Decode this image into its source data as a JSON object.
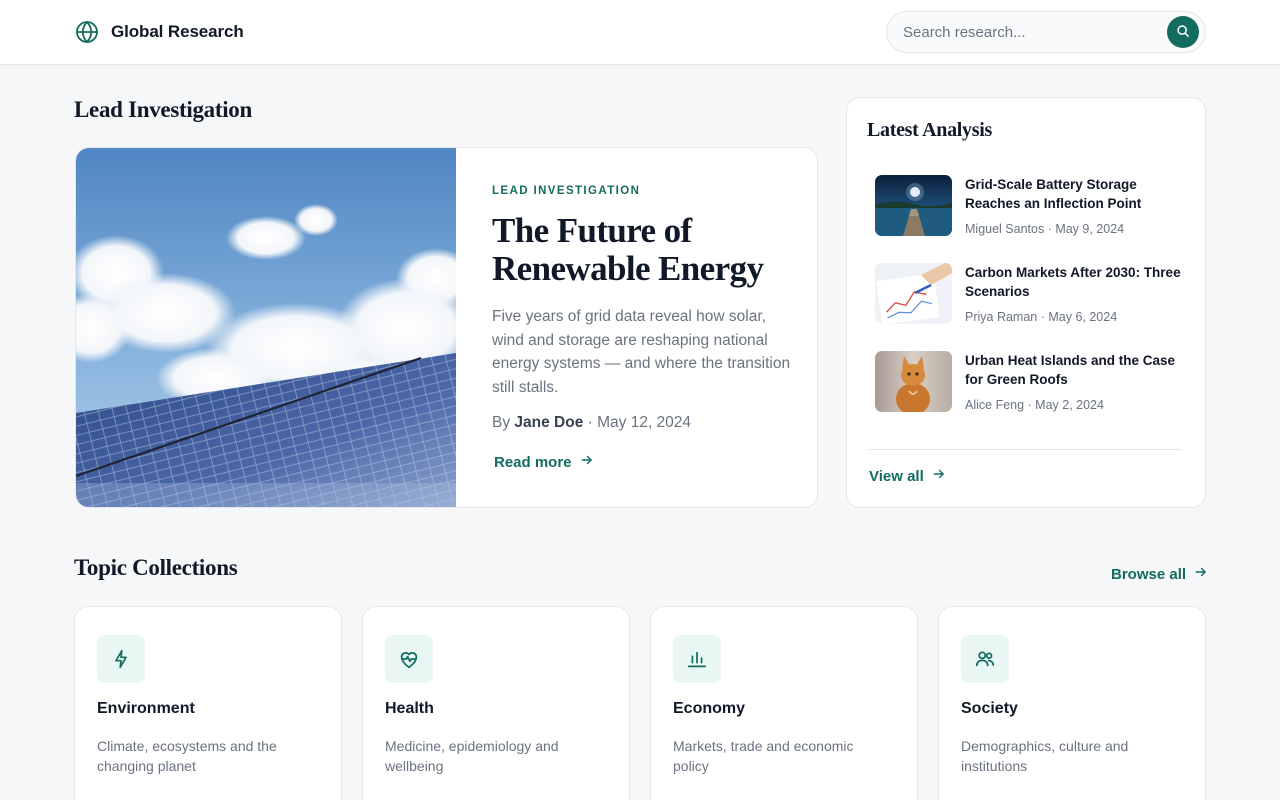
{
  "header": {
    "brand_name": "Global Research",
    "search_placeholder": "Search research..."
  },
  "lead": {
    "section_title": "Lead Investigation",
    "eyebrow": "LEAD INVESTIGATION",
    "title": "The Future of Renewable Energy",
    "description": "Five years of grid data reveal how solar, wind and storage are reshaping national energy systems — and where the transition still stalls.",
    "by_prefix": "By",
    "author": "Jane Doe",
    "date": "· May 12, 2024",
    "read_more": "Read more",
    "image_alt": "Solar panels under a blue sky with clouds"
  },
  "latest": {
    "title": "Latest Analysis",
    "items": [
      {
        "title": "Grid-Scale Battery Storage Reaches an Inflection Point",
        "meta": "Miguel Santos · May 9, 2024",
        "thumb": "pier-at-night"
      },
      {
        "title": "Carbon Markets After 2030: Three Scenarios",
        "meta": "Priya Raman · May 6, 2024",
        "thumb": "hand-charts"
      },
      {
        "title": "Urban Heat Islands and the Case for Green Roofs",
        "meta": "Alice Feng · May 2, 2024",
        "thumb": "orange-cat"
      }
    ],
    "view_all": "View all"
  },
  "topics": {
    "section_title": "Topic Collections",
    "browse_all": "Browse all",
    "items": [
      {
        "name": "Environment",
        "description": "Climate, ecosystems and the changing planet",
        "icon": "bolt-icon"
      },
      {
        "name": "Health",
        "description": "Medicine, epidemiology and wellbeing",
        "icon": "heart-pulse-icon"
      },
      {
        "name": "Economy",
        "description": "Markets, trade and economic policy",
        "icon": "bar-chart-icon"
      },
      {
        "name": "Society",
        "description": "Demographics, culture and institutions",
        "icon": "users-icon"
      }
    ]
  },
  "colors": {
    "accent": "#136c5f",
    "accent_soft": "#e8f7f3",
    "background": "#f5f7f9",
    "text": "#111827",
    "muted": "#6b7280"
  }
}
